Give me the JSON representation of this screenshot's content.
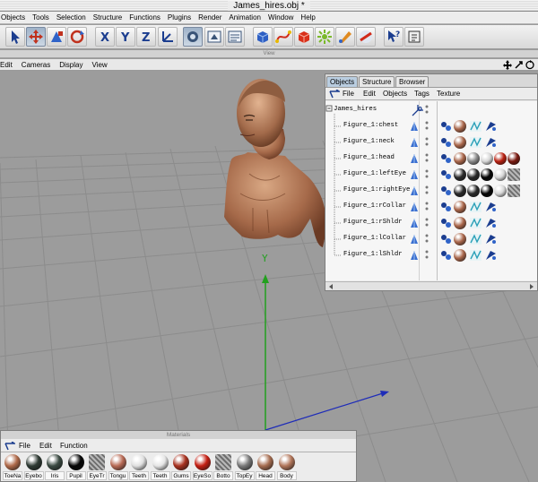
{
  "window": {
    "title": "James_hires.obj *"
  },
  "menubar": [
    "Objects",
    "Tools",
    "Selection",
    "Structure",
    "Functions",
    "Plugins",
    "Render",
    "Animation",
    "Window",
    "Help"
  ],
  "toolbar": {
    "icons": [
      "arrow-select-icon",
      "move-icon",
      "scale-icon",
      "rotate-icon",
      "x-axis-icon",
      "y-axis-icon",
      "z-axis-icon",
      "coordinate-system-icon",
      "camera-icon",
      "render-view-icon",
      "render-settings-icon",
      "cube-icon",
      "spline-icon",
      "generator-icon",
      "deformer-icon",
      "scene-icon",
      "environment-icon",
      "light-icon",
      "help-pointer-icon",
      "settings-icon"
    ]
  },
  "view_bar": {
    "label": "View"
  },
  "viewport": {
    "menu": [
      "Edit",
      "Cameras",
      "Display",
      "View"
    ],
    "axis_label": "Y"
  },
  "object_manager": {
    "tabs": [
      "Objects",
      "Structure",
      "Browser"
    ],
    "active_tab": "Objects",
    "menu": [
      "File",
      "Edit",
      "Objects",
      "Tags",
      "Texture"
    ],
    "root": "James_hires",
    "objects": [
      {
        "name": "Figure_1:chest",
        "materials": [
          "skin"
        ]
      },
      {
        "name": "Figure_1:neck",
        "materials": [
          "skin"
        ]
      },
      {
        "name": "Figure_1:head",
        "materials": [
          "skin",
          "grey",
          "white",
          "red",
          "dark-red"
        ]
      },
      {
        "name": "Figure_1:leftEye",
        "materials": [
          "dark",
          "dark",
          "black",
          "white",
          "stripe"
        ]
      },
      {
        "name": "Figure_1:rightEye",
        "materials": [
          "dark",
          "dark",
          "black",
          "white",
          "stripe"
        ]
      },
      {
        "name": "Figure_1:rCollar",
        "materials": [
          "skin"
        ]
      },
      {
        "name": "Figure_1:rShldr",
        "materials": [
          "skin"
        ]
      },
      {
        "name": "Figure_1:lCollar",
        "materials": [
          "skin"
        ]
      },
      {
        "name": "Figure_1:lShldr",
        "materials": [
          "skin"
        ]
      }
    ]
  },
  "materials_manager": {
    "title": "Materials",
    "menu": [
      "File",
      "Edit",
      "Function"
    ],
    "materials": [
      {
        "label": "ToeNa",
        "color": "#b06a4a"
      },
      {
        "label": "Eyebo",
        "color": "#2e3a33"
      },
      {
        "label": "Iris",
        "color": "#3b4a42"
      },
      {
        "label": "Pupil",
        "color": "#050505"
      },
      {
        "label": "EyeTr",
        "color": "#888888"
      },
      {
        "label": "Tongu",
        "color": "#b96b56"
      },
      {
        "label": "Teeth",
        "color": "#e0e0e0"
      },
      {
        "label": "Teeth",
        "color": "#e6e6e6"
      },
      {
        "label": "Gums",
        "color": "#a8311f"
      },
      {
        "label": "EyeSo",
        "color": "#c41e12"
      },
      {
        "label": "Botto",
        "color": "#888888"
      },
      {
        "label": "TopEy",
        "color": "#7a7a7a"
      },
      {
        "label": "Head",
        "color": "#a66d50"
      },
      {
        "label": "Body",
        "color": "#b2765a"
      }
    ]
  },
  "colors": {
    "selection_accent": "#b9cde0",
    "viewport_bg": "#9c9c9c",
    "y_axis": "#22a01e",
    "z_axis": "#1e2cb8"
  }
}
